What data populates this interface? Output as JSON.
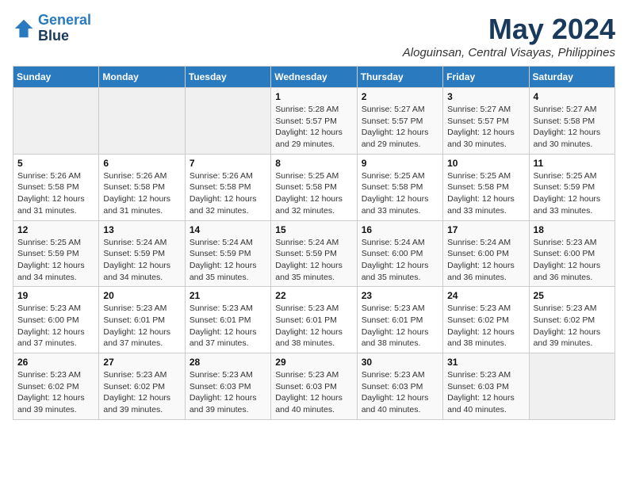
{
  "header": {
    "logo_line1": "General",
    "logo_line2": "Blue",
    "month": "May 2024",
    "location": "Aloguinsan, Central Visayas, Philippines"
  },
  "weekdays": [
    "Sunday",
    "Monday",
    "Tuesday",
    "Wednesday",
    "Thursday",
    "Friday",
    "Saturday"
  ],
  "weeks": [
    [
      {
        "day": "",
        "sunrise": "",
        "sunset": "",
        "daylight": ""
      },
      {
        "day": "",
        "sunrise": "",
        "sunset": "",
        "daylight": ""
      },
      {
        "day": "",
        "sunrise": "",
        "sunset": "",
        "daylight": ""
      },
      {
        "day": "1",
        "sunrise": "Sunrise: 5:28 AM",
        "sunset": "Sunset: 5:57 PM",
        "daylight": "Daylight: 12 hours and 29 minutes."
      },
      {
        "day": "2",
        "sunrise": "Sunrise: 5:27 AM",
        "sunset": "Sunset: 5:57 PM",
        "daylight": "Daylight: 12 hours and 29 minutes."
      },
      {
        "day": "3",
        "sunrise": "Sunrise: 5:27 AM",
        "sunset": "Sunset: 5:57 PM",
        "daylight": "Daylight: 12 hours and 30 minutes."
      },
      {
        "day": "4",
        "sunrise": "Sunrise: 5:27 AM",
        "sunset": "Sunset: 5:58 PM",
        "daylight": "Daylight: 12 hours and 30 minutes."
      }
    ],
    [
      {
        "day": "5",
        "sunrise": "Sunrise: 5:26 AM",
        "sunset": "Sunset: 5:58 PM",
        "daylight": "Daylight: 12 hours and 31 minutes."
      },
      {
        "day": "6",
        "sunrise": "Sunrise: 5:26 AM",
        "sunset": "Sunset: 5:58 PM",
        "daylight": "Daylight: 12 hours and 31 minutes."
      },
      {
        "day": "7",
        "sunrise": "Sunrise: 5:26 AM",
        "sunset": "Sunset: 5:58 PM",
        "daylight": "Daylight: 12 hours and 32 minutes."
      },
      {
        "day": "8",
        "sunrise": "Sunrise: 5:25 AM",
        "sunset": "Sunset: 5:58 PM",
        "daylight": "Daylight: 12 hours and 32 minutes."
      },
      {
        "day": "9",
        "sunrise": "Sunrise: 5:25 AM",
        "sunset": "Sunset: 5:58 PM",
        "daylight": "Daylight: 12 hours and 33 minutes."
      },
      {
        "day": "10",
        "sunrise": "Sunrise: 5:25 AM",
        "sunset": "Sunset: 5:58 PM",
        "daylight": "Daylight: 12 hours and 33 minutes."
      },
      {
        "day": "11",
        "sunrise": "Sunrise: 5:25 AM",
        "sunset": "Sunset: 5:59 PM",
        "daylight": "Daylight: 12 hours and 33 minutes."
      }
    ],
    [
      {
        "day": "12",
        "sunrise": "Sunrise: 5:25 AM",
        "sunset": "Sunset: 5:59 PM",
        "daylight": "Daylight: 12 hours and 34 minutes."
      },
      {
        "day": "13",
        "sunrise": "Sunrise: 5:24 AM",
        "sunset": "Sunset: 5:59 PM",
        "daylight": "Daylight: 12 hours and 34 minutes."
      },
      {
        "day": "14",
        "sunrise": "Sunrise: 5:24 AM",
        "sunset": "Sunset: 5:59 PM",
        "daylight": "Daylight: 12 hours and 35 minutes."
      },
      {
        "day": "15",
        "sunrise": "Sunrise: 5:24 AM",
        "sunset": "Sunset: 5:59 PM",
        "daylight": "Daylight: 12 hours and 35 minutes."
      },
      {
        "day": "16",
        "sunrise": "Sunrise: 5:24 AM",
        "sunset": "Sunset: 6:00 PM",
        "daylight": "Daylight: 12 hours and 35 minutes."
      },
      {
        "day": "17",
        "sunrise": "Sunrise: 5:24 AM",
        "sunset": "Sunset: 6:00 PM",
        "daylight": "Daylight: 12 hours and 36 minutes."
      },
      {
        "day": "18",
        "sunrise": "Sunrise: 5:23 AM",
        "sunset": "Sunset: 6:00 PM",
        "daylight": "Daylight: 12 hours and 36 minutes."
      }
    ],
    [
      {
        "day": "19",
        "sunrise": "Sunrise: 5:23 AM",
        "sunset": "Sunset: 6:00 PM",
        "daylight": "Daylight: 12 hours and 37 minutes."
      },
      {
        "day": "20",
        "sunrise": "Sunrise: 5:23 AM",
        "sunset": "Sunset: 6:01 PM",
        "daylight": "Daylight: 12 hours and 37 minutes."
      },
      {
        "day": "21",
        "sunrise": "Sunrise: 5:23 AM",
        "sunset": "Sunset: 6:01 PM",
        "daylight": "Daylight: 12 hours and 37 minutes."
      },
      {
        "day": "22",
        "sunrise": "Sunrise: 5:23 AM",
        "sunset": "Sunset: 6:01 PM",
        "daylight": "Daylight: 12 hours and 38 minutes."
      },
      {
        "day": "23",
        "sunrise": "Sunrise: 5:23 AM",
        "sunset": "Sunset: 6:01 PM",
        "daylight": "Daylight: 12 hours and 38 minutes."
      },
      {
        "day": "24",
        "sunrise": "Sunrise: 5:23 AM",
        "sunset": "Sunset: 6:02 PM",
        "daylight": "Daylight: 12 hours and 38 minutes."
      },
      {
        "day": "25",
        "sunrise": "Sunrise: 5:23 AM",
        "sunset": "Sunset: 6:02 PM",
        "daylight": "Daylight: 12 hours and 39 minutes."
      }
    ],
    [
      {
        "day": "26",
        "sunrise": "Sunrise: 5:23 AM",
        "sunset": "Sunset: 6:02 PM",
        "daylight": "Daylight: 12 hours and 39 minutes."
      },
      {
        "day": "27",
        "sunrise": "Sunrise: 5:23 AM",
        "sunset": "Sunset: 6:02 PM",
        "daylight": "Daylight: 12 hours and 39 minutes."
      },
      {
        "day": "28",
        "sunrise": "Sunrise: 5:23 AM",
        "sunset": "Sunset: 6:03 PM",
        "daylight": "Daylight: 12 hours and 39 minutes."
      },
      {
        "day": "29",
        "sunrise": "Sunrise: 5:23 AM",
        "sunset": "Sunset: 6:03 PM",
        "daylight": "Daylight: 12 hours and 40 minutes."
      },
      {
        "day": "30",
        "sunrise": "Sunrise: 5:23 AM",
        "sunset": "Sunset: 6:03 PM",
        "daylight": "Daylight: 12 hours and 40 minutes."
      },
      {
        "day": "31",
        "sunrise": "Sunrise: 5:23 AM",
        "sunset": "Sunset: 6:03 PM",
        "daylight": "Daylight: 12 hours and 40 minutes."
      },
      {
        "day": "",
        "sunrise": "",
        "sunset": "",
        "daylight": ""
      }
    ]
  ]
}
